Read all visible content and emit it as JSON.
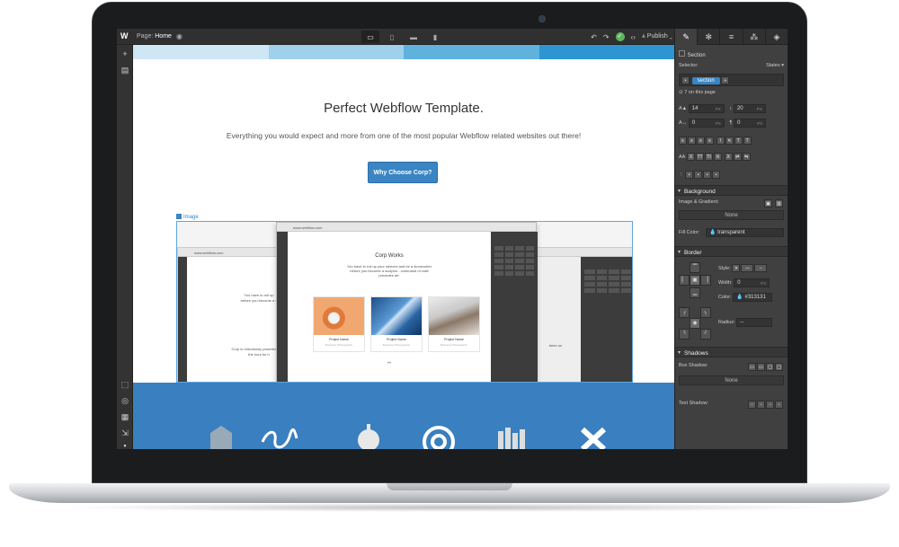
{
  "topbar": {
    "logo": "W",
    "page_label": "Page:",
    "page_name": "Home",
    "publish_label": "Publish",
    "devices": [
      "desktop",
      "tablet",
      "phone-landscape",
      "phone-portrait"
    ],
    "panel_tabs": [
      "style-brush-icon",
      "settings-gear-icon",
      "navigator-icon",
      "interactions-icon",
      "assets-cube-icon"
    ]
  },
  "canvas": {
    "stripe_colors": [
      "#cfe6f4",
      "#9fd0ec",
      "#5fb2de",
      "#2f95d0"
    ],
    "hero_title": "Perfect Webflow Template.",
    "hero_subtitle": "Everything you would expect and more from one of the most popular Webflow related websites out there!",
    "hero_button": "Why Choose Corp?",
    "image_label": "Image",
    "nested": {
      "url_center": "www.webflow.com",
      "url_left": "www.webflow.com",
      "heading": "Corp Works",
      "intro": "You have to roll up your sleeves and be a stonecutter before you become a sculptor - command of craft precedes art.",
      "left_text_1": "You have to roll up",
      "left_text_2": "before you become a s",
      "left_text_3": "Corp is ridiculously powerful and e",
      "left_text_4": "the hunt for h",
      "right_text": "been on",
      "projects": [
        {
          "name": "Project Name",
          "category": "Business Photography"
        },
        {
          "name": "Project Name",
          "category": "Business Photography"
        },
        {
          "name": "Project Name",
          "category": "Business Photography"
        }
      ]
    },
    "section_color": "#3a7fbf"
  },
  "panel": {
    "section_label": "Section",
    "selector_label": "Selector:",
    "states_label": "States",
    "selector_chip": "section",
    "on_page": "7 on this page",
    "font_size": "14",
    "font_unit": "PX",
    "line_height": "20",
    "line_unit": "PX",
    "letter_spacing": "0",
    "letter_unit": "PX",
    "word_spacing": "0",
    "word_unit": "PX",
    "background_heading": "Background",
    "image_gradient_label": "Image & Gradient:",
    "image_gradient_value": "None",
    "fill_color_label": "Fill Color:",
    "fill_color_value": "transparent",
    "border_heading": "Border",
    "style_label": "Style:",
    "width_label": "Width:",
    "width_value": "0",
    "width_unit": "PX",
    "color_label": "Color:",
    "color_value": "#313131",
    "radius_label": "Radius:",
    "radius_value": "--",
    "shadows_heading": "Shadows",
    "box_shadow_label": "Box Shadow:",
    "box_shadow_value": "None",
    "text_shadow_label": "Text Shadow:"
  }
}
